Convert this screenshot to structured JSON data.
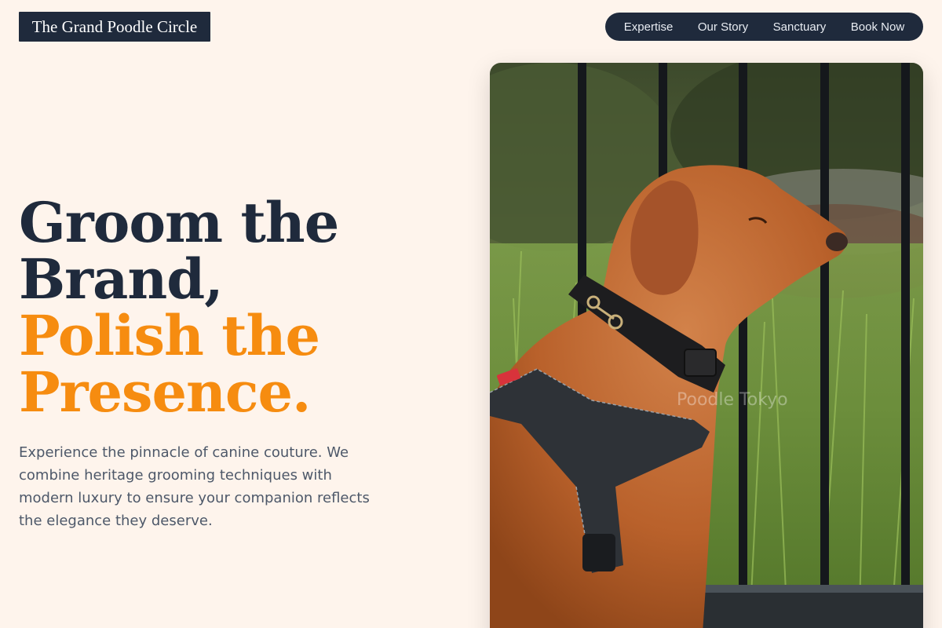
{
  "header": {
    "brand": "The Grand Poodle Circle",
    "nav": [
      "Expertise",
      "Our Story",
      "Sanctuary",
      "Book Now"
    ]
  },
  "hero": {
    "headline_dark": [
      "Groom the",
      "Brand,"
    ],
    "headline_accent": [
      "Polish the",
      "Presence."
    ],
    "description": "Experience the pinnacle of canine couture. We combine heritage grooming techniques with modern luxury to ensure your companion reflects the elegance they deserve.",
    "image_watermark": "Poodle Tokyo"
  },
  "colors": {
    "background": "#fef4ec",
    "navy": "#1f2a3c",
    "accent": "#f68c10"
  }
}
